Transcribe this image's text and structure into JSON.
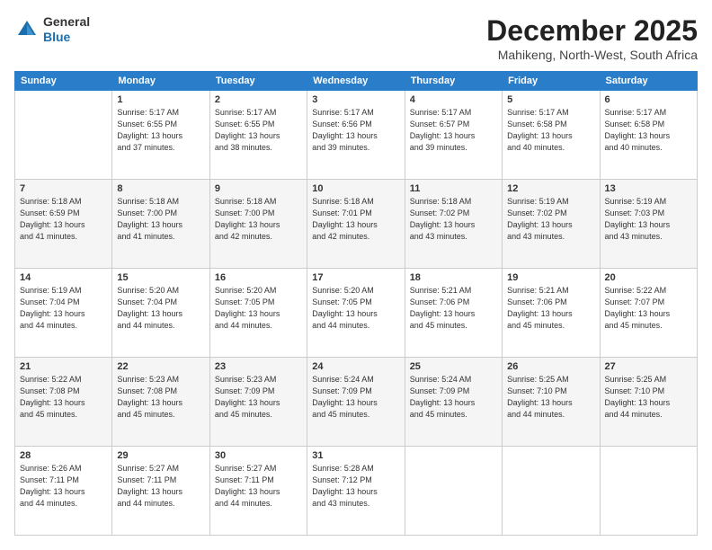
{
  "logo": {
    "general": "General",
    "blue": "Blue"
  },
  "header": {
    "month": "December 2025",
    "location": "Mahikeng, North-West, South Africa"
  },
  "days": [
    "Sunday",
    "Monday",
    "Tuesday",
    "Wednesday",
    "Thursday",
    "Friday",
    "Saturday"
  ],
  "weeks": [
    [
      {
        "day": "",
        "info": ""
      },
      {
        "day": "1",
        "info": "Sunrise: 5:17 AM\nSunset: 6:55 PM\nDaylight: 13 hours\nand 37 minutes."
      },
      {
        "day": "2",
        "info": "Sunrise: 5:17 AM\nSunset: 6:55 PM\nDaylight: 13 hours\nand 38 minutes."
      },
      {
        "day": "3",
        "info": "Sunrise: 5:17 AM\nSunset: 6:56 PM\nDaylight: 13 hours\nand 39 minutes."
      },
      {
        "day": "4",
        "info": "Sunrise: 5:17 AM\nSunset: 6:57 PM\nDaylight: 13 hours\nand 39 minutes."
      },
      {
        "day": "5",
        "info": "Sunrise: 5:17 AM\nSunset: 6:58 PM\nDaylight: 13 hours\nand 40 minutes."
      },
      {
        "day": "6",
        "info": "Sunrise: 5:17 AM\nSunset: 6:58 PM\nDaylight: 13 hours\nand 40 minutes."
      }
    ],
    [
      {
        "day": "7",
        "info": "Sunrise: 5:18 AM\nSunset: 6:59 PM\nDaylight: 13 hours\nand 41 minutes."
      },
      {
        "day": "8",
        "info": "Sunrise: 5:18 AM\nSunset: 7:00 PM\nDaylight: 13 hours\nand 41 minutes."
      },
      {
        "day": "9",
        "info": "Sunrise: 5:18 AM\nSunset: 7:00 PM\nDaylight: 13 hours\nand 42 minutes."
      },
      {
        "day": "10",
        "info": "Sunrise: 5:18 AM\nSunset: 7:01 PM\nDaylight: 13 hours\nand 42 minutes."
      },
      {
        "day": "11",
        "info": "Sunrise: 5:18 AM\nSunset: 7:02 PM\nDaylight: 13 hours\nand 43 minutes."
      },
      {
        "day": "12",
        "info": "Sunrise: 5:19 AM\nSunset: 7:02 PM\nDaylight: 13 hours\nand 43 minutes."
      },
      {
        "day": "13",
        "info": "Sunrise: 5:19 AM\nSunset: 7:03 PM\nDaylight: 13 hours\nand 43 minutes."
      }
    ],
    [
      {
        "day": "14",
        "info": "Sunrise: 5:19 AM\nSunset: 7:04 PM\nDaylight: 13 hours\nand 44 minutes."
      },
      {
        "day": "15",
        "info": "Sunrise: 5:20 AM\nSunset: 7:04 PM\nDaylight: 13 hours\nand 44 minutes."
      },
      {
        "day": "16",
        "info": "Sunrise: 5:20 AM\nSunset: 7:05 PM\nDaylight: 13 hours\nand 44 minutes."
      },
      {
        "day": "17",
        "info": "Sunrise: 5:20 AM\nSunset: 7:05 PM\nDaylight: 13 hours\nand 44 minutes."
      },
      {
        "day": "18",
        "info": "Sunrise: 5:21 AM\nSunset: 7:06 PM\nDaylight: 13 hours\nand 45 minutes."
      },
      {
        "day": "19",
        "info": "Sunrise: 5:21 AM\nSunset: 7:06 PM\nDaylight: 13 hours\nand 45 minutes."
      },
      {
        "day": "20",
        "info": "Sunrise: 5:22 AM\nSunset: 7:07 PM\nDaylight: 13 hours\nand 45 minutes."
      }
    ],
    [
      {
        "day": "21",
        "info": "Sunrise: 5:22 AM\nSunset: 7:08 PM\nDaylight: 13 hours\nand 45 minutes."
      },
      {
        "day": "22",
        "info": "Sunrise: 5:23 AM\nSunset: 7:08 PM\nDaylight: 13 hours\nand 45 minutes."
      },
      {
        "day": "23",
        "info": "Sunrise: 5:23 AM\nSunset: 7:09 PM\nDaylight: 13 hours\nand 45 minutes."
      },
      {
        "day": "24",
        "info": "Sunrise: 5:24 AM\nSunset: 7:09 PM\nDaylight: 13 hours\nand 45 minutes."
      },
      {
        "day": "25",
        "info": "Sunrise: 5:24 AM\nSunset: 7:09 PM\nDaylight: 13 hours\nand 45 minutes."
      },
      {
        "day": "26",
        "info": "Sunrise: 5:25 AM\nSunset: 7:10 PM\nDaylight: 13 hours\nand 44 minutes."
      },
      {
        "day": "27",
        "info": "Sunrise: 5:25 AM\nSunset: 7:10 PM\nDaylight: 13 hours\nand 44 minutes."
      }
    ],
    [
      {
        "day": "28",
        "info": "Sunrise: 5:26 AM\nSunset: 7:11 PM\nDaylight: 13 hours\nand 44 minutes."
      },
      {
        "day": "29",
        "info": "Sunrise: 5:27 AM\nSunset: 7:11 PM\nDaylight: 13 hours\nand 44 minutes."
      },
      {
        "day": "30",
        "info": "Sunrise: 5:27 AM\nSunset: 7:11 PM\nDaylight: 13 hours\nand 44 minutes."
      },
      {
        "day": "31",
        "info": "Sunrise: 5:28 AM\nSunset: 7:12 PM\nDaylight: 13 hours\nand 43 minutes."
      },
      {
        "day": "",
        "info": ""
      },
      {
        "day": "",
        "info": ""
      },
      {
        "day": "",
        "info": ""
      }
    ]
  ]
}
